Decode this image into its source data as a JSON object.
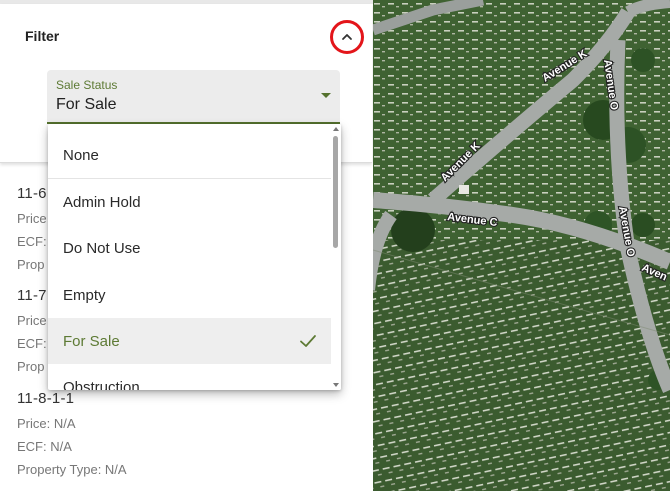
{
  "filter": {
    "title": "Filter",
    "collapse_icon": "chevron-up-icon",
    "highlight_color": "#e3151a"
  },
  "sale_status": {
    "label": "Sale Status",
    "value": "For Sale",
    "accent_color": "#5d7a34"
  },
  "menu": {
    "options": [
      {
        "label": "None"
      },
      {
        "label": "Admin Hold"
      },
      {
        "label": "Do Not Use"
      },
      {
        "label": "Empty"
      },
      {
        "label": "For Sale",
        "selected": true
      },
      {
        "label": "Obstruction"
      }
    ]
  },
  "plots": [
    {
      "name": "11-6",
      "price": "Price",
      "ecf": "ECF:",
      "property": "Prop"
    },
    {
      "name": "11-7",
      "price": "Price",
      "ecf": "ECF:",
      "property": "Prop"
    },
    {
      "name": "11-8-1-1",
      "price": "Price: N/A",
      "ecf": "ECF: N/A",
      "property": "Property Type: N/A"
    }
  ],
  "map": {
    "streets": [
      "Avenue K",
      "Avenue O",
      "Avenue K",
      "Avenue C",
      "Avenue O",
      "Aven"
    ]
  }
}
